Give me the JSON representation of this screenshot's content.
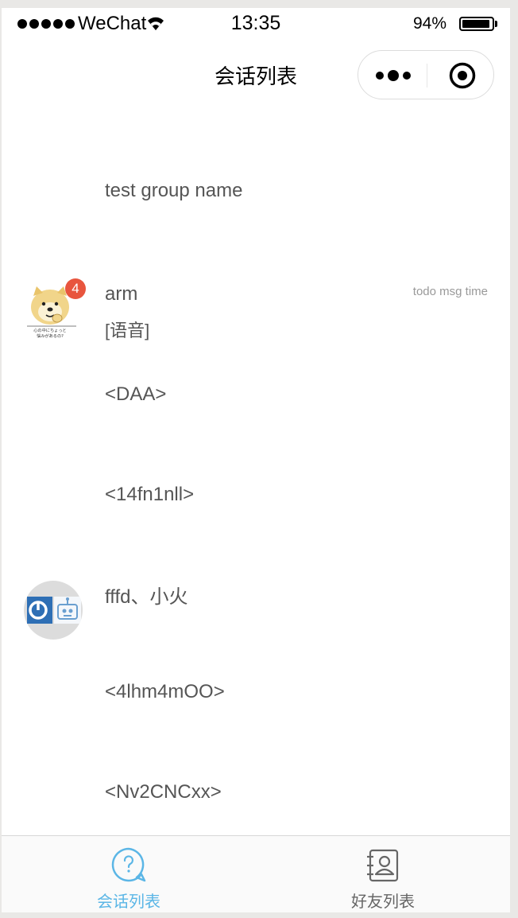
{
  "status_bar": {
    "carrier": "WeChat",
    "time": "13:35",
    "battery": "94%",
    "battery_level": 0.94
  },
  "nav": {
    "title": "会话列表"
  },
  "conversations": [
    {
      "name": "test group name"
    },
    {
      "name": "arm",
      "time": "todo msg time",
      "preview": "[语音]",
      "badge": "4"
    },
    {
      "name": "<DAA>"
    },
    {
      "name": "<14fn1nll>"
    },
    {
      "name": "fffd、小火"
    },
    {
      "name": "<4lhm4mOO>"
    },
    {
      "name": "<Nv2CNCxx>"
    }
  ],
  "avatar_meme_caption": "心の中にちょっと\n悩みがあるの?",
  "tabbar": {
    "tabs": [
      {
        "label": "会话列表",
        "active": true,
        "color": "#5bb6e6"
      },
      {
        "label": "好友列表",
        "active": false,
        "color": "#666666"
      }
    ]
  }
}
